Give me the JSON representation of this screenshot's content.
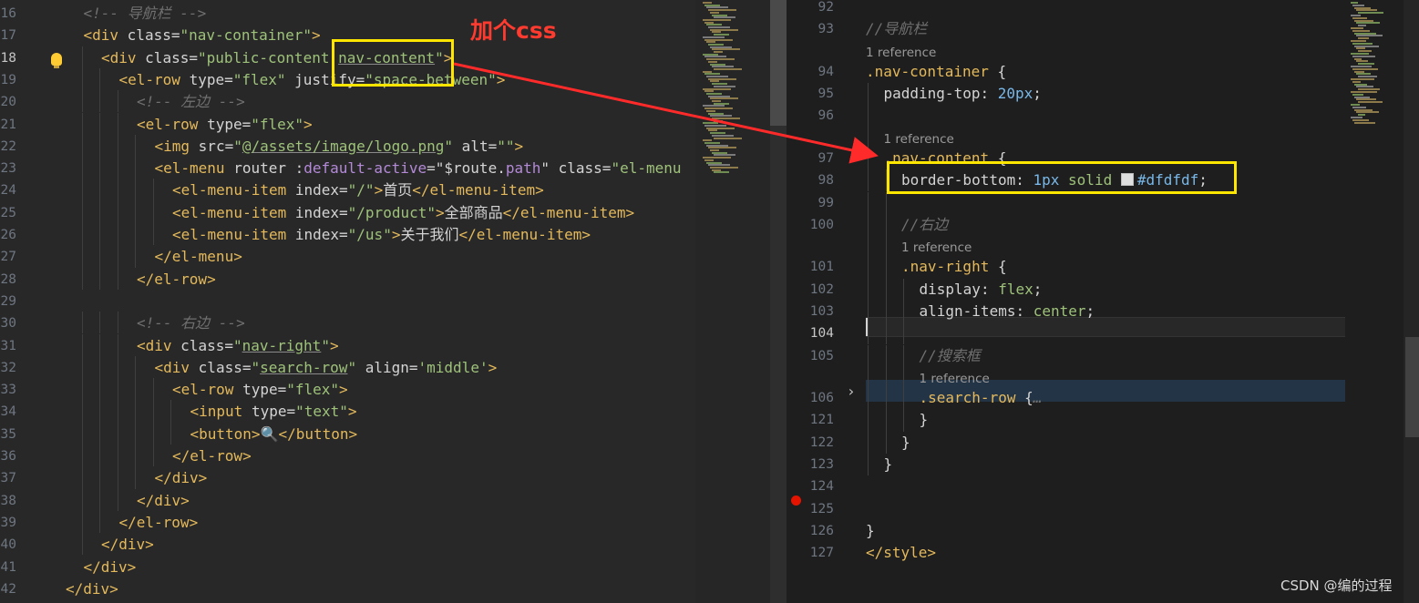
{
  "annotation": {
    "label": "加个css",
    "color": "#ff3b30",
    "box_color": "#ffe600"
  },
  "watermark": "CSDN @编的过程",
  "left_editor": {
    "line_numbers": [
      "16",
      "17",
      "18",
      "19",
      "20",
      "21",
      "22",
      "23",
      "24",
      "25",
      "26",
      "27",
      "28",
      "29",
      "30",
      "31",
      "32",
      "33",
      "34",
      "35",
      "36",
      "37",
      "38",
      "39",
      "40",
      "41",
      "42"
    ],
    "active_line": "18",
    "lines": [
      [
        {
          "c": "t-cmt",
          "t": "<!-- 导航栏 -->"
        }
      ],
      [
        {
          "c": "t-tag",
          "t": "<div "
        },
        {
          "c": "t-attr",
          "t": "class="
        },
        {
          "c": "t-str",
          "t": "\"nav-container\""
        },
        {
          "c": "t-tag",
          "t": ">"
        }
      ],
      [
        {
          "c": "t-tag",
          "t": "<div "
        },
        {
          "c": "t-attr",
          "t": "class="
        },
        {
          "c": "t-str",
          "t": "\"public-content "
        },
        {
          "c": "t-str uline",
          "t": "nav-content"
        },
        {
          "c": "t-str",
          "t": "\""
        },
        {
          "c": "t-tag",
          "t": ">"
        }
      ],
      [
        {
          "c": "t-tag",
          "t": "<el-row "
        },
        {
          "c": "t-attr",
          "t": "type="
        },
        {
          "c": "t-str",
          "t": "\"flex\""
        },
        {
          "c": "t-attr",
          "t": " justify="
        },
        {
          "c": "t-str",
          "t": "\"space-between\""
        },
        {
          "c": "t-tag",
          "t": ">"
        }
      ],
      [
        {
          "c": "t-cmt",
          "t": "<!-- 左边 -->"
        }
      ],
      [
        {
          "c": "t-tag",
          "t": "<el-row "
        },
        {
          "c": "t-attr",
          "t": "type="
        },
        {
          "c": "t-str",
          "t": "\"flex\""
        },
        {
          "c": "t-tag",
          "t": ">"
        }
      ],
      [
        {
          "c": "t-tag",
          "t": "<img "
        },
        {
          "c": "t-attr",
          "t": "src="
        },
        {
          "c": "t-str",
          "t": "\""
        },
        {
          "c": "t-str uline",
          "t": "@/assets/image/logo.png"
        },
        {
          "c": "t-str",
          "t": "\""
        },
        {
          "c": "t-attr",
          "t": " alt="
        },
        {
          "c": "t-str",
          "t": "\"\""
        },
        {
          "c": "t-tag",
          "t": ">"
        }
      ],
      [
        {
          "c": "t-tag",
          "t": "<el-menu "
        },
        {
          "c": "t-attr",
          "t": "router :"
        },
        {
          "c": "t-dir",
          "t": "default-active"
        },
        {
          "c": "t-attr",
          "t": "="
        },
        {
          "c": "t-txt",
          "t": "\"$route."
        },
        {
          "c": "t-dir",
          "t": "path"
        },
        {
          "c": "t-txt",
          "t": "\""
        },
        {
          "c": "t-attr",
          "t": " class="
        },
        {
          "c": "t-str",
          "t": "\"el-menu"
        }
      ],
      [
        {
          "c": "t-tag",
          "t": "<el-menu-item "
        },
        {
          "c": "t-attr",
          "t": "index="
        },
        {
          "c": "t-str",
          "t": "\"/\""
        },
        {
          "c": "t-tag",
          "t": ">"
        },
        {
          "c": "t-txt",
          "t": "首页"
        },
        {
          "c": "t-tag",
          "t": "</el-menu-item>"
        }
      ],
      [
        {
          "c": "t-tag",
          "t": "<el-menu-item "
        },
        {
          "c": "t-attr",
          "t": "index="
        },
        {
          "c": "t-str",
          "t": "\"/product\""
        },
        {
          "c": "t-tag",
          "t": ">"
        },
        {
          "c": "t-txt",
          "t": "全部商品"
        },
        {
          "c": "t-tag",
          "t": "</el-menu-item>"
        }
      ],
      [
        {
          "c": "t-tag",
          "t": "<el-menu-item "
        },
        {
          "c": "t-attr",
          "t": "index="
        },
        {
          "c": "t-str",
          "t": "\"/us\""
        },
        {
          "c": "t-tag",
          "t": ">"
        },
        {
          "c": "t-txt",
          "t": "关于我们"
        },
        {
          "c": "t-tag",
          "t": "</el-menu-item>"
        }
      ],
      [
        {
          "c": "t-tag",
          "t": "</el-menu>"
        }
      ],
      [
        {
          "c": "t-tag",
          "t": "</el-row>"
        }
      ],
      [],
      [
        {
          "c": "t-cmt",
          "t": "<!-- 右边 -->"
        }
      ],
      [
        {
          "c": "t-tag",
          "t": "<div "
        },
        {
          "c": "t-attr",
          "t": "class="
        },
        {
          "c": "t-str",
          "t": "\""
        },
        {
          "c": "t-str uline",
          "t": "nav-right"
        },
        {
          "c": "t-str",
          "t": "\""
        },
        {
          "c": "t-tag",
          "t": ">"
        }
      ],
      [
        {
          "c": "t-tag",
          "t": "<div "
        },
        {
          "c": "t-attr",
          "t": "class="
        },
        {
          "c": "t-str",
          "t": "\""
        },
        {
          "c": "t-str uline",
          "t": "search-row"
        },
        {
          "c": "t-str",
          "t": "\""
        },
        {
          "c": "t-attr",
          "t": " align="
        },
        {
          "c": "t-str",
          "t": "'middle'"
        },
        {
          "c": "t-tag",
          "t": ">"
        }
      ],
      [
        {
          "c": "t-tag",
          "t": "<el-row "
        },
        {
          "c": "t-attr",
          "t": "type="
        },
        {
          "c": "t-str",
          "t": "\"flex\""
        },
        {
          "c": "t-tag",
          "t": ">"
        }
      ],
      [
        {
          "c": "t-tag",
          "t": "<input "
        },
        {
          "c": "t-attr",
          "t": "type="
        },
        {
          "c": "t-str",
          "t": "\"text\""
        },
        {
          "c": "t-tag",
          "t": ">"
        }
      ],
      [
        {
          "c": "t-tag",
          "t": "<button>"
        },
        {
          "c": "t-txt",
          "t": "🔍"
        },
        {
          "c": "t-tag",
          "t": "</button>"
        }
      ],
      [
        {
          "c": "t-tag",
          "t": "</el-row>"
        }
      ],
      [
        {
          "c": "t-tag",
          "t": "</div>"
        }
      ],
      [
        {
          "c": "t-tag",
          "t": "</div>"
        }
      ],
      [
        {
          "c": "t-tag",
          "t": "</el-row>"
        }
      ],
      [
        {
          "c": "t-tag",
          "t": "</div>"
        }
      ],
      [
        {
          "c": "t-tag",
          "t": "</div>"
        }
      ],
      [
        {
          "c": "t-tag",
          "t": "</div>"
        }
      ]
    ],
    "indents": [
      1,
      1,
      2,
      3,
      4,
      4,
      5,
      5,
      6,
      6,
      6,
      5,
      4,
      0,
      4,
      4,
      5,
      6,
      7,
      7,
      6,
      5,
      4,
      3,
      2,
      1,
      0
    ]
  },
  "right_editor": {
    "rows": [
      {
        "type": "code",
        "num": "92",
        "indent": 0,
        "tokens": []
      },
      {
        "type": "code",
        "num": "93",
        "indent": 0,
        "tokens": [
          {
            "c": "t-cmt",
            "t": "//导航栏"
          }
        ]
      },
      {
        "type": "ref",
        "indent": 0,
        "text": "1 reference"
      },
      {
        "type": "code",
        "num": "94",
        "indent": 0,
        "tokens": [
          {
            "c": "t-sel",
            "t": ".nav-container"
          },
          {
            "c": "t-punc",
            "t": " {"
          }
        ]
      },
      {
        "type": "code",
        "num": "95",
        "indent": 1,
        "tokens": [
          {
            "c": "t-prop",
            "t": "padding-top"
          },
          {
            "c": "t-punc",
            "t": ": "
          },
          {
            "c": "t-num",
            "t": "20px"
          },
          {
            "c": "t-punc",
            "t": ";"
          }
        ]
      },
      {
        "type": "code",
        "num": "96",
        "indent": 1,
        "tokens": []
      },
      {
        "type": "ref",
        "indent": 1,
        "text": "1 reference"
      },
      {
        "type": "code",
        "num": "97",
        "indent": 1,
        "tokens": [
          {
            "c": "t-sel",
            "t": ".nav-content"
          },
          {
            "c": "t-punc",
            "t": " {"
          }
        ]
      },
      {
        "type": "code",
        "num": "98",
        "indent": 2,
        "tokens": [
          {
            "c": "t-prop",
            "t": "border-bottom"
          },
          {
            "c": "t-punc",
            "t": ": "
          },
          {
            "c": "t-num",
            "t": "1px"
          },
          {
            "c": "t-kw",
            "t": " solid "
          },
          {
            "c": "swatch",
            "t": ""
          },
          {
            "c": "t-hex",
            "t": "#dfdfdf"
          },
          {
            "c": "t-punc",
            "t": ";"
          }
        ]
      },
      {
        "type": "code",
        "num": "99",
        "indent": 2,
        "tokens": []
      },
      {
        "type": "code",
        "num": "100",
        "indent": 2,
        "tokens": [
          {
            "c": "t-cmt",
            "t": "//右边"
          }
        ]
      },
      {
        "type": "ref",
        "indent": 2,
        "text": "1 reference"
      },
      {
        "type": "code",
        "num": "101",
        "indent": 2,
        "tokens": [
          {
            "c": "t-sel",
            "t": ".nav-right"
          },
          {
            "c": "t-punc",
            "t": " {"
          }
        ]
      },
      {
        "type": "code",
        "num": "102",
        "indent": 3,
        "tokens": [
          {
            "c": "t-prop",
            "t": "display"
          },
          {
            "c": "t-punc",
            "t": ": "
          },
          {
            "c": "t-kw",
            "t": "flex"
          },
          {
            "c": "t-punc",
            "t": ";"
          }
        ]
      },
      {
        "type": "code",
        "num": "103",
        "indent": 3,
        "tokens": [
          {
            "c": "t-prop",
            "t": "align-items"
          },
          {
            "c": "t-punc",
            "t": ": "
          },
          {
            "c": "t-kw",
            "t": "center"
          },
          {
            "c": "t-punc",
            "t": ";"
          }
        ]
      },
      {
        "type": "code",
        "num": "104",
        "indent": 3,
        "tokens": [],
        "active": true
      },
      {
        "type": "code",
        "num": "105",
        "indent": 3,
        "tokens": [
          {
            "c": "t-cmt",
            "t": "//搜索框"
          }
        ]
      },
      {
        "type": "ref",
        "indent": 3,
        "text": "1 reference"
      },
      {
        "type": "code",
        "num": "106",
        "indent": 3,
        "tokens": [
          {
            "c": "t-sel",
            "t": ".search-row"
          },
          {
            "c": "t-punc",
            "t": " {"
          },
          {
            "c": "t-cmt",
            "t": "…"
          }
        ]
      },
      {
        "type": "code",
        "num": "121",
        "indent": 3,
        "tokens": [
          {
            "c": "t-punc",
            "t": "}"
          }
        ]
      },
      {
        "type": "code",
        "num": "122",
        "indent": 2,
        "tokens": [
          {
            "c": "t-punc",
            "t": "}"
          }
        ]
      },
      {
        "type": "code",
        "num": "123",
        "indent": 1,
        "tokens": [
          {
            "c": "t-punc",
            "t": "}"
          }
        ]
      },
      {
        "type": "code",
        "num": "124",
        "indent": 0,
        "tokens": []
      },
      {
        "type": "code",
        "num": "125",
        "indent": 0,
        "tokens": []
      },
      {
        "type": "code",
        "num": "126",
        "indent": 0,
        "tokens": [
          {
            "c": "t-punc",
            "t": "}"
          }
        ]
      },
      {
        "type": "code",
        "num": "127",
        "indent": 0,
        "tokens": [
          {
            "c": "t-tag",
            "t": "</style>"
          }
        ]
      }
    ]
  },
  "icons": {
    "lightbulb": "lightbulb-icon",
    "breakpoint": "breakpoint-icon",
    "fold": "chevron-right-icon",
    "color_swatch": "color-swatch-icon"
  }
}
